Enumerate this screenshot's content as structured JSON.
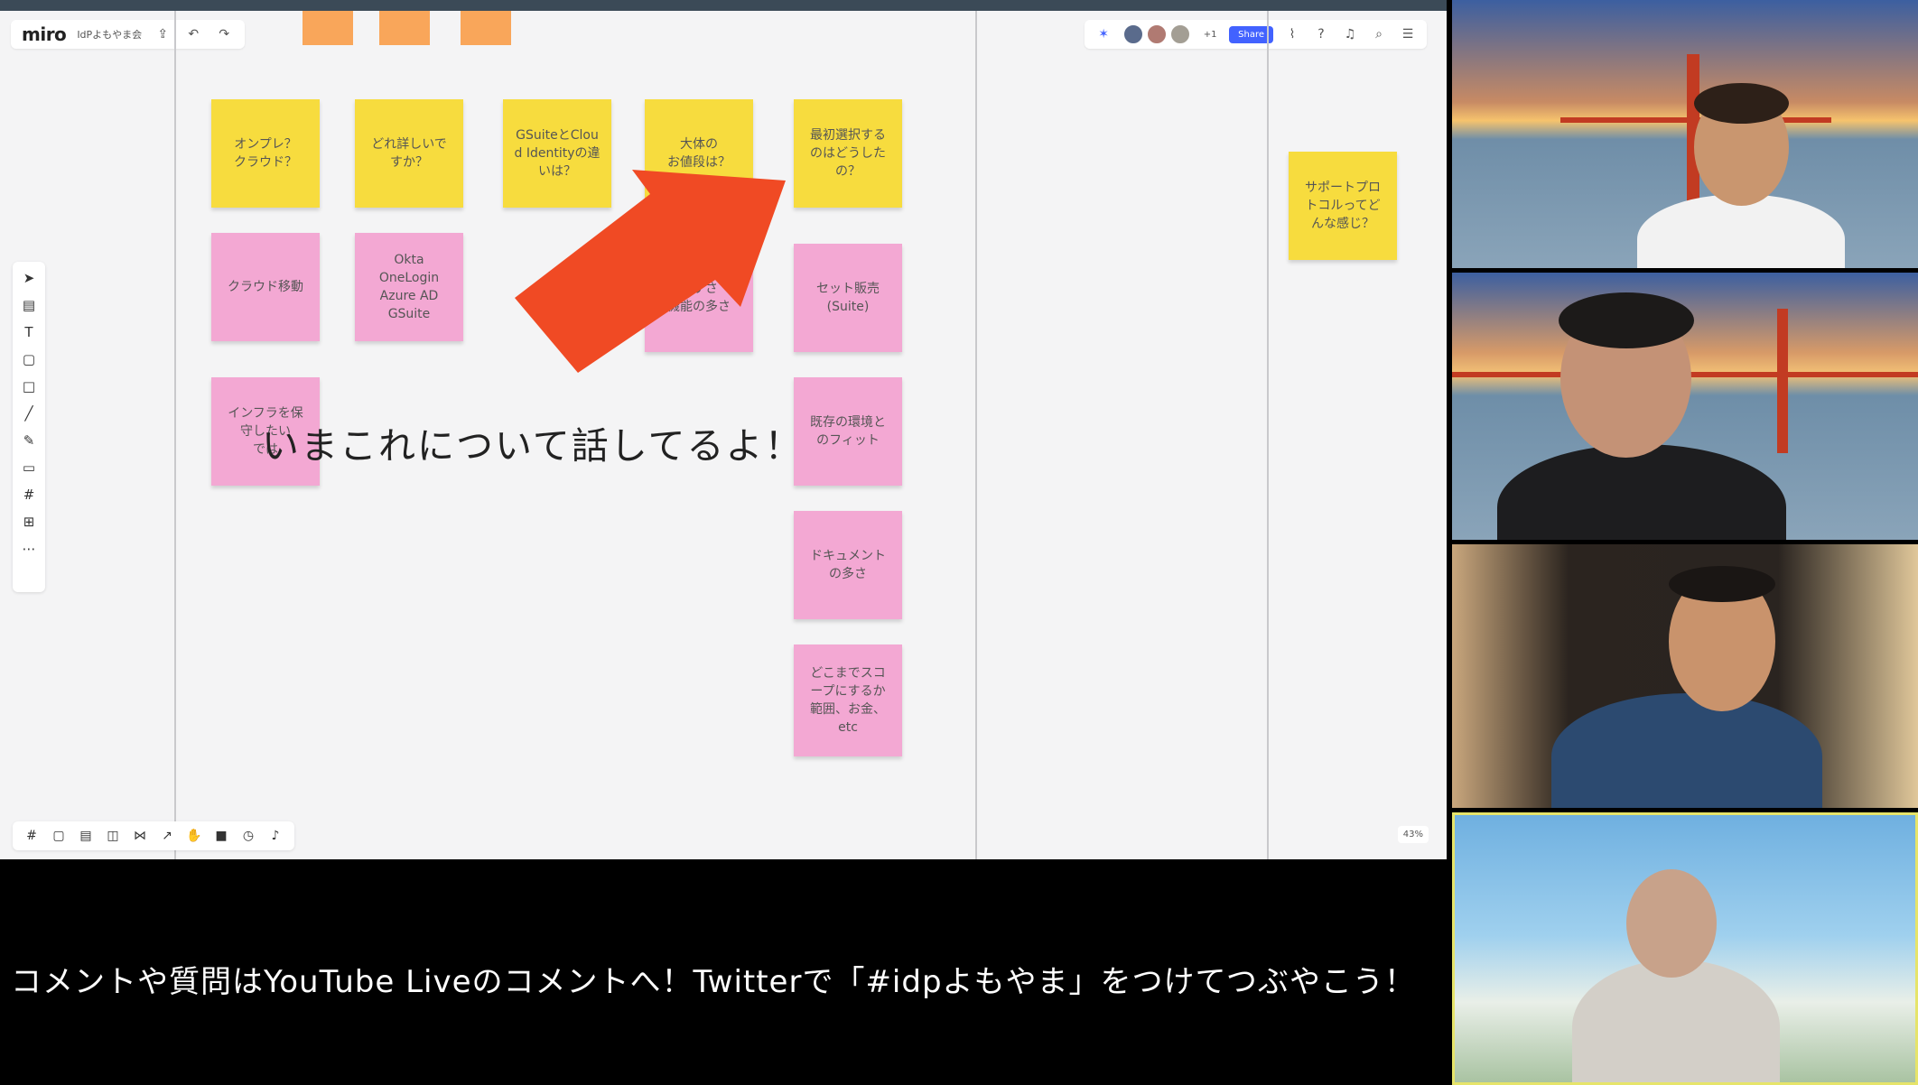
{
  "miro": {
    "logo": "miro",
    "board_name": "IdPよもやま会",
    "share_label": "Share",
    "zoom": "43%",
    "accent": "#4262ff"
  },
  "left_tools": [
    "cursor-icon",
    "template-icon",
    "text-icon",
    "sticky-note-icon",
    "shape-icon",
    "pen-icon",
    "pencil-icon",
    "comment-icon",
    "frame-icon",
    "upload-icon",
    "more-icon"
  ],
  "left_tool_glyphs": [
    "➤",
    "▤",
    "T",
    "▢",
    "□",
    "╱",
    "✎",
    "▭",
    "#",
    "⊞",
    "⋯"
  ],
  "bottom_tool_glyphs": [
    "#",
    "▢",
    "▤",
    "◫",
    "⋈",
    "↗",
    "✋",
    "■",
    "◷",
    "♪"
  ],
  "stickies": {
    "s1": "オンプレ？\nクラウド？",
    "s2": "どれ詳しいで\nすか？",
    "s3": "GSuiteとClou\nd Identityの違\nいは？",
    "s4": "大体の\nお値段は？",
    "s5": "最初選択する\nのはどうした\nの？",
    "s6": "クラウド移動",
    "s7": "Okta\nOneLogin\nAzure AD\nGSuite",
    "s8": "やすさ\n機能の多さ",
    "s9": "セット販売\n(Suite)",
    "s10": "インフラを保\n守したい\nでは",
    "s11": "既存の環境と\nのフィット",
    "s12": "ドキュメント\nの多さ",
    "s13": "どこまでスコ\nープにするか\n範囲、お金、\netc",
    "s14": "サポートプロ\nトコルってど\nんな感じ？"
  },
  "overlay_text": "いまこれについて話してるよ！",
  "caption": "コメントや質問はYouTube Liveのコメントへ！Twitterで「#idpよもやま」をつけてつぶやこう！",
  "colors": {
    "sticky_yellow": "#f7dc3e",
    "sticky_pink": "#f3a8d3",
    "arrow": "#f04a24"
  }
}
